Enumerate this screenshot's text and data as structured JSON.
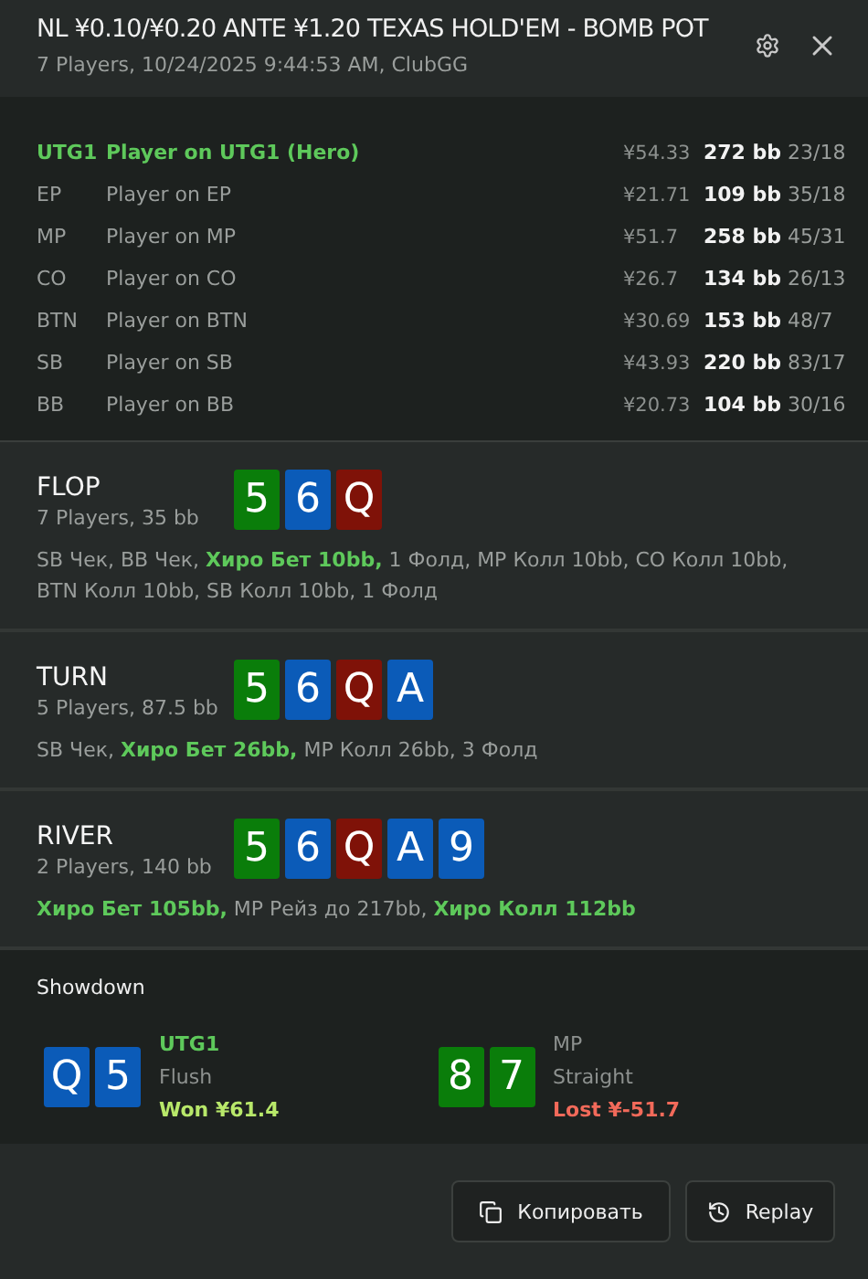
{
  "header": {
    "title": "NL ¥0.10/¥0.20 ANTE ¥1.20 TEXAS HOLD'EM - BOMB POT",
    "subtitle": "7 Players, 10/24/2025 9:44:53 AM, ClubGG"
  },
  "players": [
    {
      "position": "UTG1",
      "name": "Player on UTG1 (Hero)",
      "hero": true,
      "stack": "¥54.33",
      "bb": "272 bb",
      "stats": "23/18"
    },
    {
      "position": "EP",
      "name": "Player on EP",
      "hero": false,
      "stack": "¥21.71",
      "bb": "109 bb",
      "stats": "35/18"
    },
    {
      "position": "MP",
      "name": "Player on MP",
      "hero": false,
      "stack": "¥51.7",
      "bb": "258 bb",
      "stats": "45/31"
    },
    {
      "position": "CO",
      "name": "Player on CO",
      "hero": false,
      "stack": "¥26.7",
      "bb": "134 bb",
      "stats": "26/13"
    },
    {
      "position": "BTN",
      "name": "Player on BTN",
      "hero": false,
      "stack": "¥30.69",
      "bb": "153 bb",
      "stats": "48/7"
    },
    {
      "position": "SB",
      "name": "Player on SB",
      "hero": false,
      "stack": "¥43.93",
      "bb": "220 bb",
      "stats": "83/17"
    },
    {
      "position": "BB",
      "name": "Player on BB",
      "hero": false,
      "stack": "¥20.73",
      "bb": "104 bb",
      "stats": "30/16"
    }
  ],
  "streets": [
    {
      "name": "FLOP",
      "info": "7 Players, 35 bb",
      "cards": [
        {
          "rank": "5",
          "color": "#0a7d0a"
        },
        {
          "rank": "6",
          "color": "#0b5bb8"
        },
        {
          "rank": "Q",
          "color": "#7f1208"
        }
      ],
      "actions": "SB Чек, BB Чек, **Хиро Бет 10bb,** 1 Фолд, MP Колл 10bb, CO Колл 10bb, BTN Колл 10bb, SB Колл 10bb, 1 Фолд"
    },
    {
      "name": "TURN",
      "info": "5 Players, 87.5 bb",
      "cards": [
        {
          "rank": "5",
          "color": "#0a7d0a"
        },
        {
          "rank": "6",
          "color": "#0b5bb8"
        },
        {
          "rank": "Q",
          "color": "#7f1208"
        },
        {
          "rank": "A",
          "color": "#0b5bb8"
        }
      ],
      "actions": "SB Чек, **Хиро Бет 26bb,** MP Колл 26bb, 3 Фолд"
    },
    {
      "name": "RIVER",
      "info": "2 Players, 140 bb",
      "cards": [
        {
          "rank": "5",
          "color": "#0a7d0a"
        },
        {
          "rank": "6",
          "color": "#0b5bb8"
        },
        {
          "rank": "Q",
          "color": "#7f1208"
        },
        {
          "rank": "A",
          "color": "#0b5bb8"
        },
        {
          "rank": "9",
          "color": "#0b5bb8"
        }
      ],
      "actions": "**Хиро Бет 105bb,** MP Рейз до 217bb, **Хиро Колл 112bb**"
    }
  ],
  "showdown": {
    "title": "Showdown",
    "hands": [
      {
        "cards": [
          {
            "rank": "Q",
            "color": "#0b5bb8"
          },
          {
            "rank": "5",
            "color": "#0b5bb8"
          }
        ],
        "position": "UTG1",
        "hero": true,
        "hand": "Flush",
        "kind": "won",
        "result": "Won ¥61.4"
      },
      {
        "cards": [
          {
            "rank": "8",
            "color": "#0a7d0a"
          },
          {
            "rank": "7",
            "color": "#0a7d0a"
          }
        ],
        "position": "MP",
        "hero": false,
        "hand": "Straight",
        "kind": "lost",
        "result": "Lost ¥-51.7"
      }
    ]
  },
  "buttons": [
    {
      "kind": "copy",
      "label": "Копировать"
    },
    {
      "kind": "replay",
      "label": "Replay"
    }
  ]
}
